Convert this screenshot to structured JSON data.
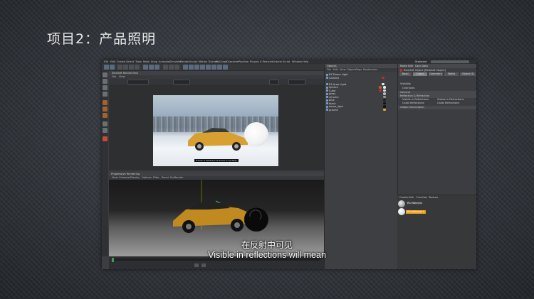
{
  "slide": {
    "title": "项目2：产品照明"
  },
  "app": {
    "menu": [
      "File",
      "Edit",
      "Create",
      "Select",
      "Tools",
      "Mesh",
      "Snap",
      "Animate",
      "Simulate",
      "Render",
      "Sculpt",
      "Motion Tracker",
      "MoGraph",
      "Character",
      "Pipeline",
      "Plugins",
      "X-Particles",
      "Octane",
      "Script",
      "Window",
      "Help"
    ],
    "layout_label": "Standard",
    "viewport_top": {
      "title": "Redshift RenderView",
      "menu": [
        "File",
        "View"
      ],
      "frame_label": "Frame: 0    2018-10-12 16:07:11 (0.82s)"
    },
    "viewport_bottom": {
      "title": "Progressive Rendering",
      "menu": [
        "View",
        "Cameras",
        "Display",
        "Options",
        "Filter",
        "Panel",
        "ProRender"
      ]
    },
    "objects_panel": {
      "title": "Objects",
      "menu": [
        "File",
        "Edit",
        "View",
        "Objects",
        "Tags",
        "Bookmarks"
      ],
      "rows": [
        "RS Dome Light",
        "Camera",
        "",
        "RS Area Light",
        "Sphere",
        "Cube",
        "glass",
        "chrome",
        "blue",
        "black",
        "dome_light",
        "ground"
      ]
    },
    "attributes_panel": {
      "mode_label": "Mode",
      "edit_label": "Edit",
      "user_data_label": "User Data",
      "object_title": "Redshift Object [Redshift Object]",
      "tabs": [
        "Basic",
        "Coord.",
        "Geometry",
        "Matte",
        "Object ID"
      ],
      "sections": [
        "Visibility",
        "Overrides",
        "General",
        "Reflection & Refraction",
        "Visible in Reflections",
        "Visible in Refractions",
        "Casts Reflections",
        "Casts Refractions",
        "Global Illumination"
      ]
    },
    "material_panel": {
      "menu": [
        "Create",
        "Edit",
        "Function",
        "Texture"
      ],
      "items": [
        "RS Material",
        "RS Material.1"
      ]
    }
  },
  "subtitles": {
    "chinese": "在反射中可见",
    "english": "Visible in reflections will mean"
  },
  "colors": {
    "accent_orange": "#f0a020",
    "car_yellow": "#d8a030"
  }
}
